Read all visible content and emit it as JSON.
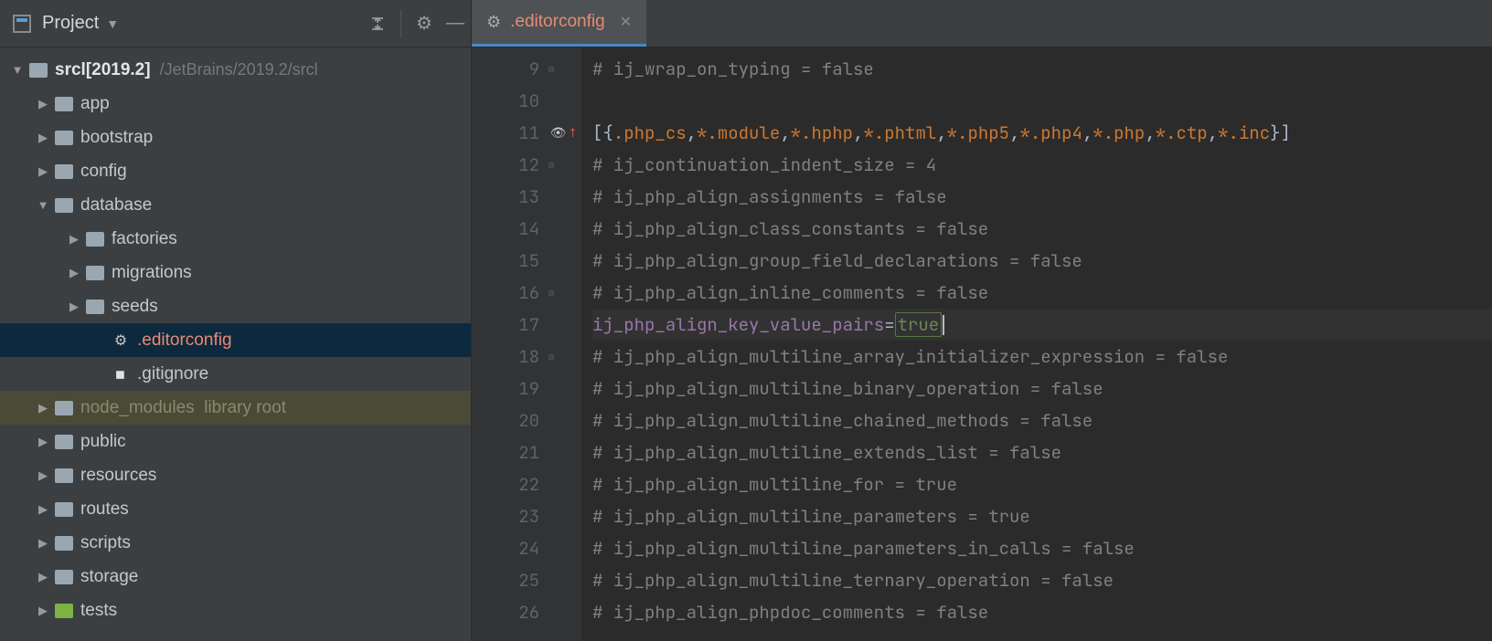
{
  "toolbar": {
    "project_label": "Project"
  },
  "tab": {
    "filename": ".editorconfig"
  },
  "tree": {
    "root_name": "srcl",
    "root_version": "[2019.2]",
    "root_path": "/JetBrains/2019.2/srcl",
    "items": [
      {
        "label": "app"
      },
      {
        "label": "bootstrap"
      },
      {
        "label": "config"
      },
      {
        "label": "database",
        "expanded": true,
        "children": [
          {
            "label": "factories"
          },
          {
            "label": "migrations"
          },
          {
            "label": "seeds"
          },
          {
            "label": ".editorconfig",
            "file": "gear",
            "selected": true
          },
          {
            "label": ".gitignore",
            "file": "git"
          }
        ]
      },
      {
        "label": "node_modules",
        "lib": true,
        "hint": "library root"
      },
      {
        "label": "public"
      },
      {
        "label": "resources"
      },
      {
        "label": "routes"
      },
      {
        "label": "scripts"
      },
      {
        "label": "storage"
      },
      {
        "label": "tests",
        "tests": true
      }
    ]
  },
  "editor": {
    "first_line": 9,
    "lines": [
      {
        "n": 9,
        "type": "comment",
        "fold": "end",
        "text": "# ij_wrap_on_typing = false"
      },
      {
        "n": 10,
        "type": "blank",
        "text": ""
      },
      {
        "n": 11,
        "type": "section",
        "eye": true,
        "text": "[{.php_cs,*.module,*.hphp,*.phtml,*.php5,*.php4,*.php,*.ctp,*.inc}]"
      },
      {
        "n": 12,
        "type": "comment",
        "fold": "start",
        "text": "# ij_continuation_indent_size = 4"
      },
      {
        "n": 13,
        "type": "comment",
        "text": "# ij_php_align_assignments = false"
      },
      {
        "n": 14,
        "type": "comment",
        "text": "# ij_php_align_class_constants = false"
      },
      {
        "n": 15,
        "type": "comment",
        "text": "# ij_php_align_group_field_declarations = false"
      },
      {
        "n": 16,
        "type": "comment",
        "fold": "end",
        "text": "# ij_php_align_inline_comments = false"
      },
      {
        "n": 17,
        "type": "setting",
        "key": "ij_php_align_key_value_pairs",
        "value": "true",
        "hl": true,
        "caret": true
      },
      {
        "n": 18,
        "type": "comment",
        "fold": "start",
        "text": "# ij_php_align_multiline_array_initializer_expression = false"
      },
      {
        "n": 19,
        "type": "comment",
        "text": "# ij_php_align_multiline_binary_operation = false"
      },
      {
        "n": 20,
        "type": "comment",
        "text": "# ij_php_align_multiline_chained_methods = false"
      },
      {
        "n": 21,
        "type": "comment",
        "text": "# ij_php_align_multiline_extends_list = false"
      },
      {
        "n": 22,
        "type": "comment",
        "text": "# ij_php_align_multiline_for = true"
      },
      {
        "n": 23,
        "type": "comment",
        "text": "# ij_php_align_multiline_parameters = true"
      },
      {
        "n": 24,
        "type": "comment",
        "text": "# ij_php_align_multiline_parameters_in_calls = false"
      },
      {
        "n": 25,
        "type": "comment",
        "text": "# ij_php_align_multiline_ternary_operation = false"
      },
      {
        "n": 26,
        "type": "comment",
        "text": "# ij_php_align_phpdoc_comments = false"
      }
    ]
  }
}
